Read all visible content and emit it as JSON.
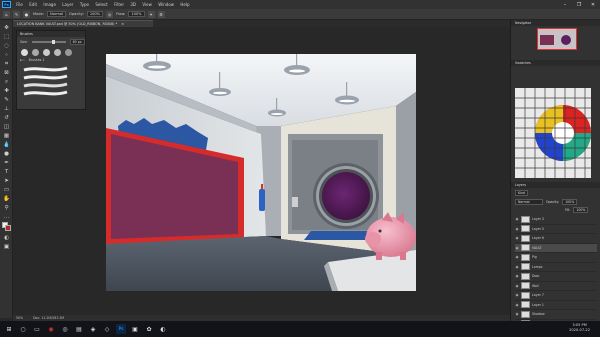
{
  "app": {
    "logo": "Ps"
  },
  "menu": [
    "File",
    "Edit",
    "Image",
    "Layer",
    "Type",
    "Select",
    "Filter",
    "3D",
    "View",
    "Window",
    "Help"
  ],
  "window_controls": [
    "–",
    "❐",
    "✕"
  ],
  "options": {
    "mode_label": "Mode:",
    "mode_value": "Normal",
    "opacity_label": "Opacity:",
    "opacity_value": "100%",
    "flow_label": "Flow:",
    "flow_value": "100%"
  },
  "document": {
    "tab_title": "LOCATION BANK VAULT.psd @ 50% (OLD_RIBBON, RGB/8) *",
    "close": "×"
  },
  "brushes_panel": {
    "title": "Brushes",
    "size_label": "Size:",
    "size_value": "60 px",
    "group_label": "Brushes 1"
  },
  "status": {
    "zoom": "50%",
    "doc_info": "Doc: 11.2M/583.3M"
  },
  "right": {
    "navigator_title": "Navigator",
    "swatches_title": "Swatches",
    "layers_title": "Layers",
    "kind_label": "Kind",
    "blend_label": "Normal",
    "opacity_label": "Opacity:",
    "opacity_value": "100%",
    "fill_label": "Fill:",
    "fill_value": "100%",
    "layers": [
      {
        "name": "Layer 3"
      },
      {
        "name": "Layer 5"
      },
      {
        "name": "Layer 6"
      },
      {
        "name": "VAULT"
      },
      {
        "name": "Pig"
      },
      {
        "name": "Lamps"
      },
      {
        "name": "Door"
      },
      {
        "name": "Wall"
      },
      {
        "name": "Layer 7"
      },
      {
        "name": "Layer 1"
      },
      {
        "name": "Shadow"
      },
      {
        "name": "Layer 4"
      }
    ]
  },
  "taskbar": {
    "time": "3:05 PM",
    "date": "2020-07-22"
  },
  "colors": {
    "accent": "#31a8ff",
    "frame": "#d62b2b",
    "board": "#7a2f55",
    "door": "#5c1f5e",
    "pig": "#e58fa8"
  }
}
